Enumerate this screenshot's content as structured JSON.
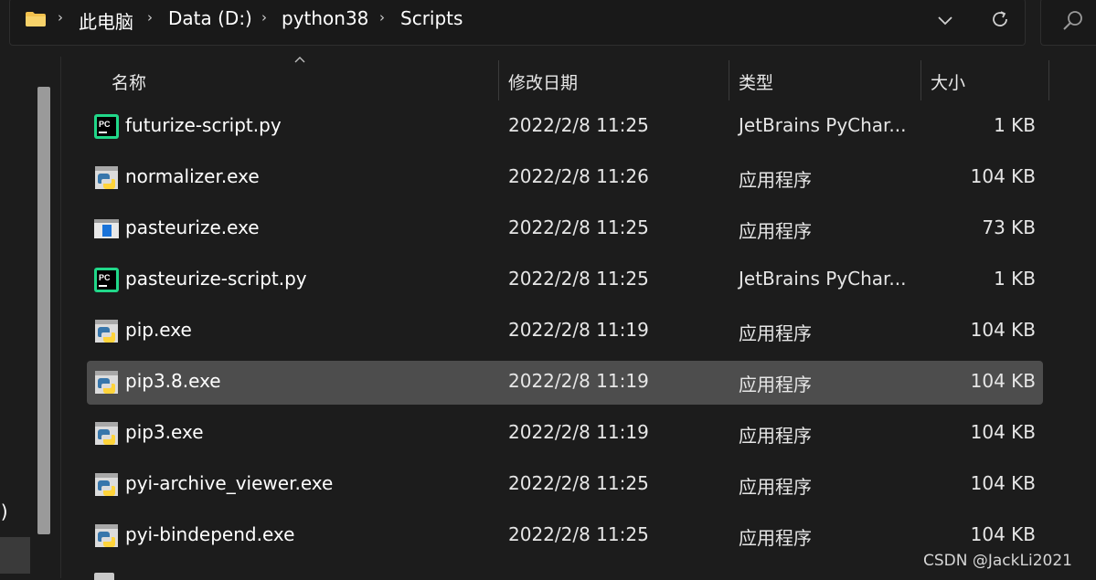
{
  "address_bar": {
    "breadcrumbs": [
      "此电脑",
      "Data (D:)",
      "python38",
      "Scripts"
    ],
    "folder_icon": "folder-icon",
    "dropdown_icon": "chevron-down-icon",
    "refresh_icon": "refresh-icon"
  },
  "search": {
    "icon": "search-icon"
  },
  "nav_pane": {
    "partial_label": ":)"
  },
  "columns": {
    "name": "名称",
    "date": "修改日期",
    "type": "类型",
    "size": "大小"
  },
  "files": [
    {
      "name": "futurize-script.py",
      "date": "2022/2/8 11:25",
      "type": "JetBrains PyChar...",
      "size": "1 KB",
      "icon": "pycharm-icon"
    },
    {
      "name": "normalizer.exe",
      "date": "2022/2/8 11:26",
      "type": "应用程序",
      "size": "104 KB",
      "icon": "python-exe-icon"
    },
    {
      "name": "pasteurize.exe",
      "date": "2022/2/8 11:25",
      "type": "应用程序",
      "size": "73 KB",
      "icon": "window-exe-icon"
    },
    {
      "name": "pasteurize-script.py",
      "date": "2022/2/8 11:25",
      "type": "JetBrains PyChar...",
      "size": "1 KB",
      "icon": "pycharm-icon"
    },
    {
      "name": "pip.exe",
      "date": "2022/2/8 11:19",
      "type": "应用程序",
      "size": "104 KB",
      "icon": "python-exe-icon"
    },
    {
      "name": "pip3.8.exe",
      "date": "2022/2/8 11:19",
      "type": "应用程序",
      "size": "104 KB",
      "icon": "python-exe-icon",
      "selected": true
    },
    {
      "name": "pip3.exe",
      "date": "2022/2/8 11:19",
      "type": "应用程序",
      "size": "104 KB",
      "icon": "python-exe-icon"
    },
    {
      "name": "pyi-archive_viewer.exe",
      "date": "2022/2/8 11:25",
      "type": "应用程序",
      "size": "104 KB",
      "icon": "python-exe-icon"
    },
    {
      "name": "pyi-bindepend.exe",
      "date": "2022/2/8 11:25",
      "type": "应用程序",
      "size": "104 KB",
      "icon": "python-exe-icon"
    }
  ],
  "watermark": "CSDN @JackLi2021"
}
